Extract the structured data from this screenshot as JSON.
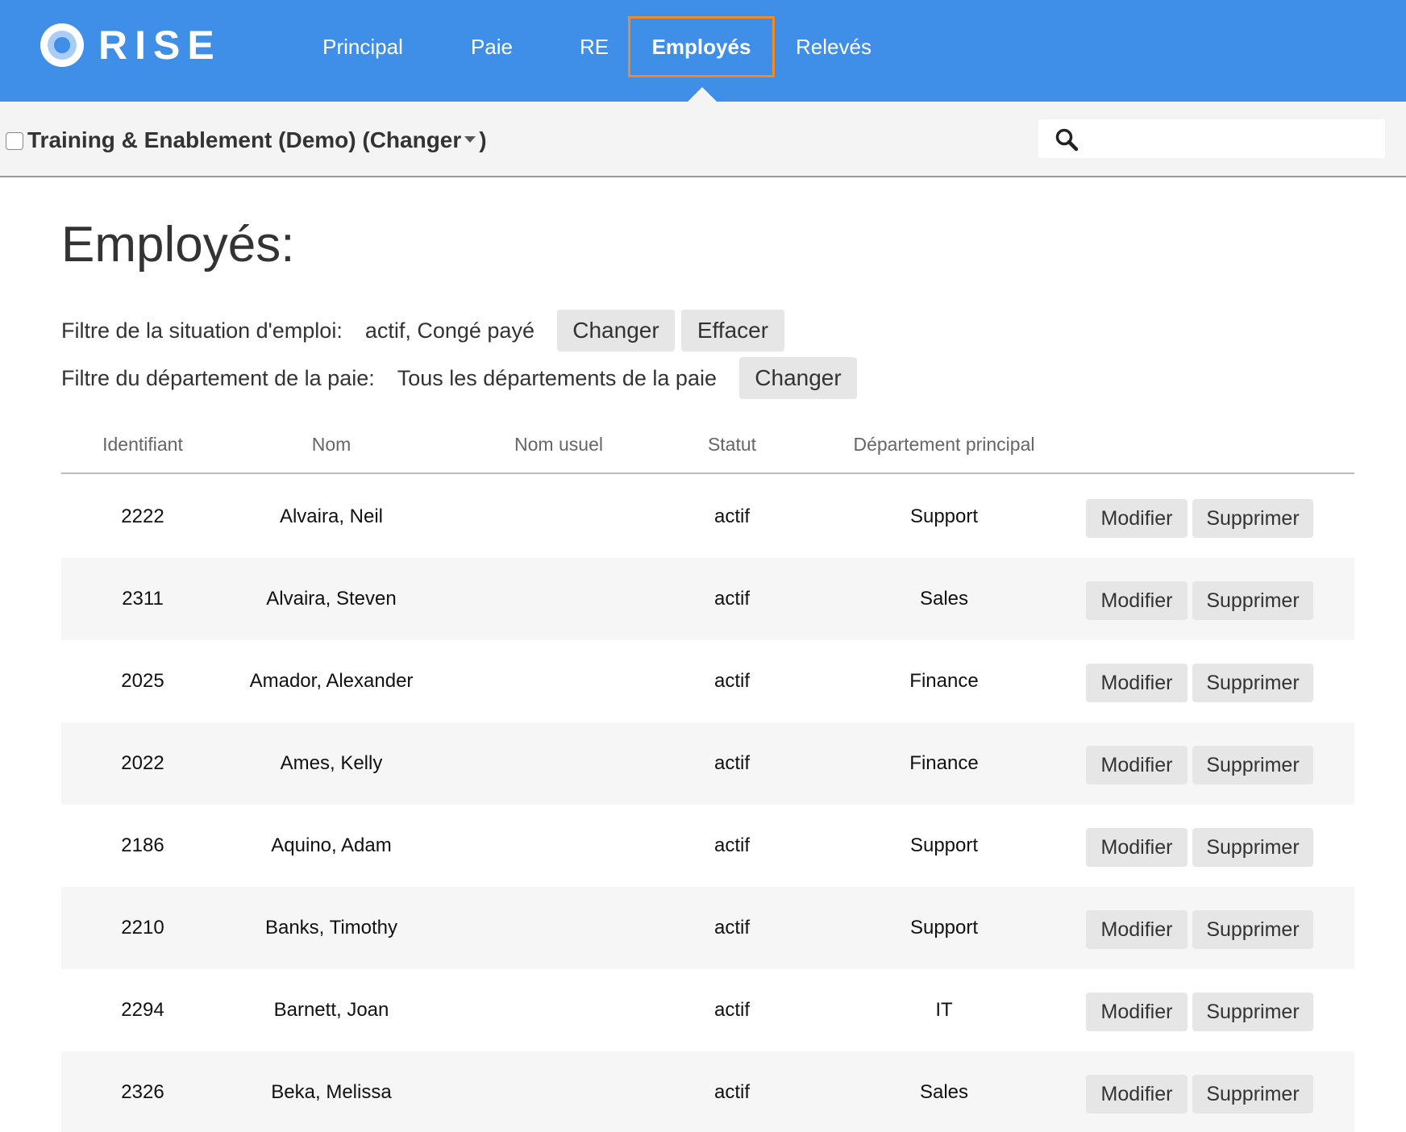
{
  "app": {
    "logo_text": "RISE",
    "nav": [
      {
        "label": "Principal",
        "active": false
      },
      {
        "label": "Paie",
        "active": false
      },
      {
        "label": "RE",
        "active": false
      },
      {
        "label": "Employés",
        "active": true
      },
      {
        "label": "Relevés",
        "active": false
      }
    ],
    "accent_color": "#3f8fe8",
    "highlight_color": "#f08a24"
  },
  "subbar": {
    "company_name": "Training & Enablement (Demo) (Changer",
    "company_suffix": ")",
    "search_placeholder": ""
  },
  "main": {
    "title": "Employés:",
    "filters": {
      "employment": {
        "label": "Filtre de la situation d'emploi:",
        "value": "actif, Congé payé",
        "change_label": "Changer",
        "clear_label": "Effacer"
      },
      "department": {
        "label": "Filtre du département de la paie:",
        "value": "Tous les départements de la paie",
        "change_label": "Changer"
      }
    },
    "table": {
      "columns": [
        "Identifiant",
        "Nom",
        "Nom usuel",
        "Statut",
        "Département principal"
      ],
      "edit_label": "Modifier",
      "delete_label": "Supprimer",
      "rows": [
        {
          "id": "2222",
          "name": "Alvaira, Neil",
          "nickname": "",
          "status": "actif",
          "department": "Support"
        },
        {
          "id": "2311",
          "name": "Alvaira, Steven",
          "nickname": "",
          "status": "actif",
          "department": "Sales"
        },
        {
          "id": "2025",
          "name": "Amador, Alexander",
          "nickname": "",
          "status": "actif",
          "department": "Finance"
        },
        {
          "id": "2022",
          "name": "Ames, Kelly",
          "nickname": "",
          "status": "actif",
          "department": "Finance"
        },
        {
          "id": "2186",
          "name": "Aquino, Adam",
          "nickname": "",
          "status": "actif",
          "department": "Support"
        },
        {
          "id": "2210",
          "name": "Banks, Timothy",
          "nickname": "",
          "status": "actif",
          "department": "Support"
        },
        {
          "id": "2294",
          "name": "Barnett, Joan",
          "nickname": "",
          "status": "actif",
          "department": "IT"
        },
        {
          "id": "2326",
          "name": "Beka, Melissa",
          "nickname": "",
          "status": "actif",
          "department": "Sales"
        }
      ]
    }
  }
}
